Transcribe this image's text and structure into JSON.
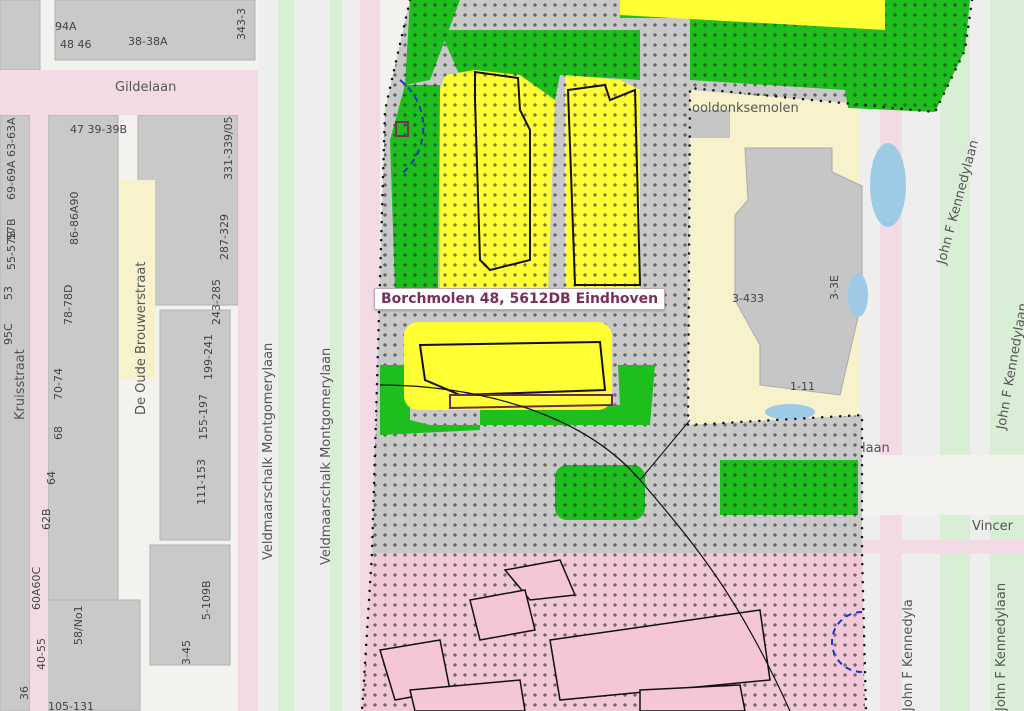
{
  "popup": {
    "address": "Borchmolen 48, 5612DB Eindhoven"
  },
  "streets": {
    "gildelaan": "Gildelaan",
    "kruisstraat": "Kruisstraat",
    "de_oude_brouwerstraat": "De Oude Brouwerstraat",
    "veldmaarschalk_1": "Veldmaarschalk Montgomerylaan",
    "veldmaarschalk_2": "Veldmaarschalk Montgomerylaan",
    "kennedylaan_1": "John F Kennedylaan",
    "kennedylaan_2": "John F Kennedylaan",
    "kennedylaan_3": "John F Kennedyla",
    "kennedylaan_4": "John F Kennedylaan",
    "kennedylaan_5": "John F Kennedyla",
    "ooldonksemolen": "ooldonksemolen",
    "laan_fragment": "laan",
    "vincent_fragment": "Vincer"
  },
  "house_numbers": [
    "94A",
    "48 46",
    "38-38A",
    "343-3",
    "47 39-39B",
    "331-339/05",
    "69-69A 63-63A",
    "57B",
    "86-86A90",
    "287-329",
    "53",
    "55-57B",
    "78-78D",
    "243-285",
    "199-241",
    "95C",
    "70-74",
    "155-197",
    "68",
    "111-153",
    "64",
    "62B",
    "60A60C",
    "58/No1",
    "3-45",
    "5-109B",
    "36",
    "40-55",
    "105-131",
    "3-433",
    "3-3E",
    "1-11"
  ],
  "colors": {
    "green": "#1fbe1f",
    "yellow": "#ffff33",
    "pink": "#f0c8d8",
    "gray": "#c8c8c8",
    "beige": "#f7f2cc",
    "water": "#9dcbe6",
    "accent": "#7a2e5a",
    "blue_symbol": "#1a33cc"
  }
}
